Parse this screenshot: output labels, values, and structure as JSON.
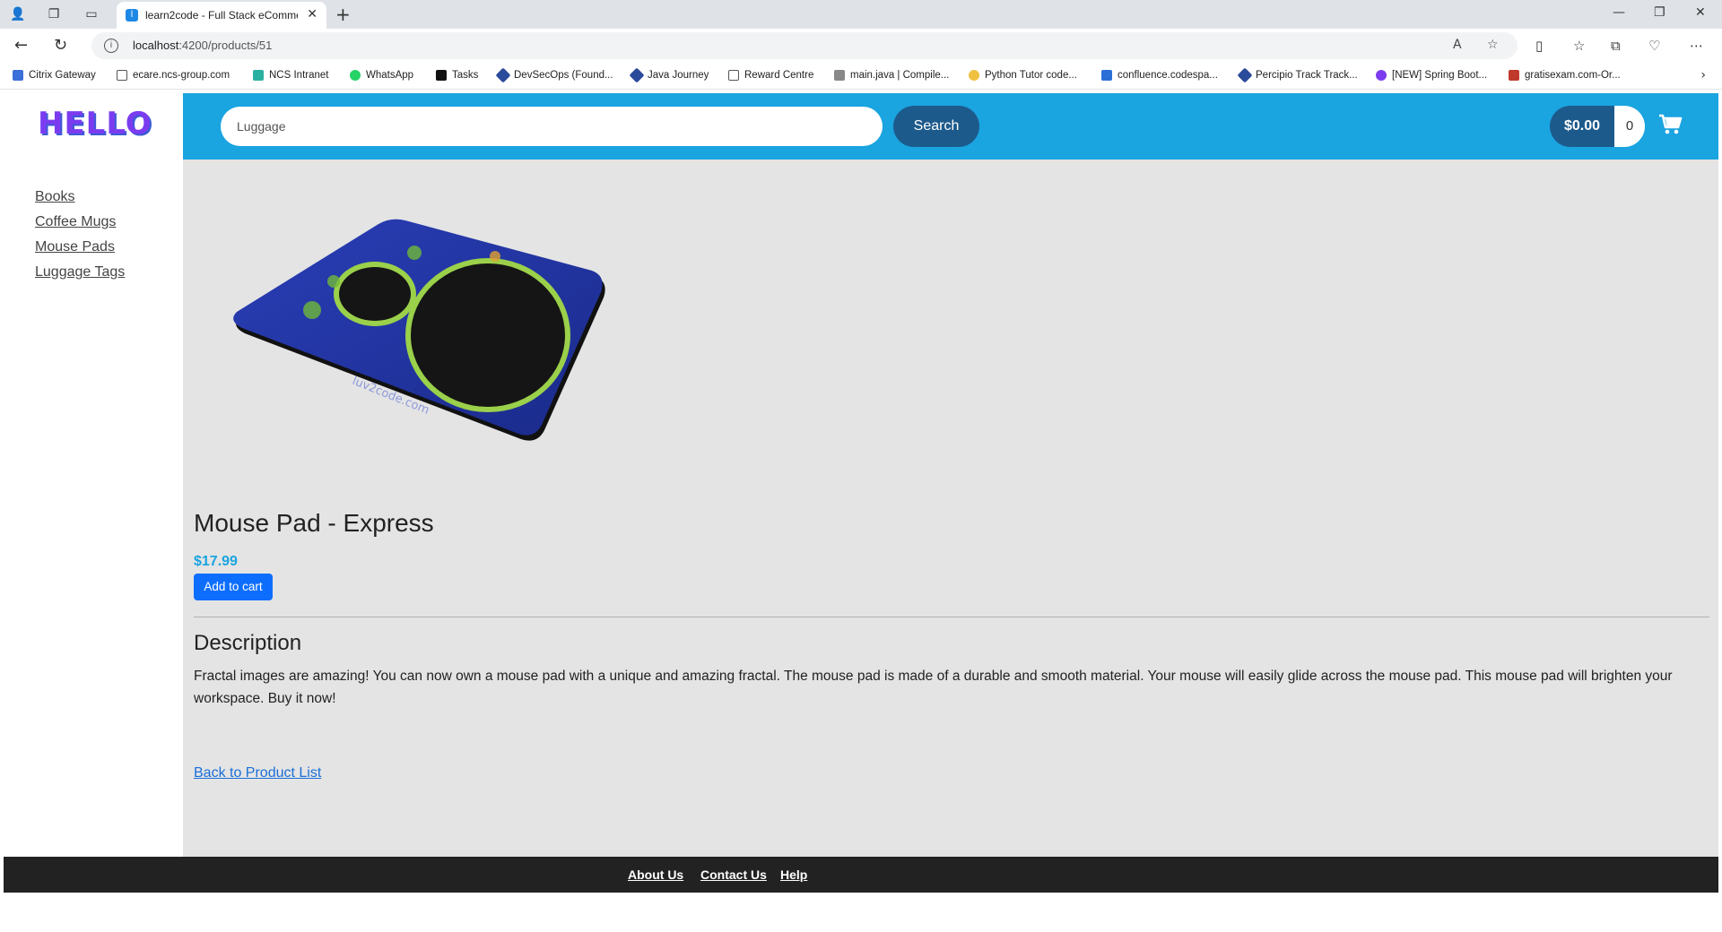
{
  "browser": {
    "tab_title": "learn2code - Full Stack eCommerce",
    "url_host": "localhost",
    "url_path": ":4200/products/51",
    "bookmarks": [
      "Citrix Gateway",
      "ecare.ncs-group.com",
      "NCS Intranet",
      "WhatsApp",
      "Tasks",
      "DevSecOps (Found...",
      "Java Journey",
      "Reward Centre",
      "main.java | Compile...",
      "Python Tutor code...",
      "confluence.codespa...",
      "Percipio Track Track...",
      "[NEW] Spring Boot...",
      "gratisexam.com-Or..."
    ]
  },
  "header": {
    "logo": "HELLO",
    "search_value": "Luggage",
    "search_label": "Search",
    "cart_total": "$0.00",
    "cart_count": "0"
  },
  "sidebar": {
    "items": [
      "Books",
      "Coffee Mugs",
      "Mouse Pads",
      "Luggage Tags"
    ]
  },
  "product": {
    "title": "Mouse Pad - Express",
    "price": "$17.99",
    "add_to_cart": "Add to cart",
    "description_heading": "Description",
    "description": "Fractal images are amazing! You can now own a mouse pad with a unique and amazing fractal. The mouse pad is made of a durable and smooth material. Your mouse will easily glide across the mouse pad. This mouse pad will brighten your workspace. Buy it now!",
    "image_watermark": "luv2code.com",
    "back_link": "Back to Product List"
  },
  "footer": {
    "links": [
      "About Us",
      "Contact Us",
      "Help"
    ]
  },
  "colors": {
    "header_bg": "#1aa4e0",
    "button_dark": "#1d5a8c",
    "primary": "#0d6efd",
    "footer_bg": "#222222",
    "content_bg": "#e4e4e4"
  }
}
